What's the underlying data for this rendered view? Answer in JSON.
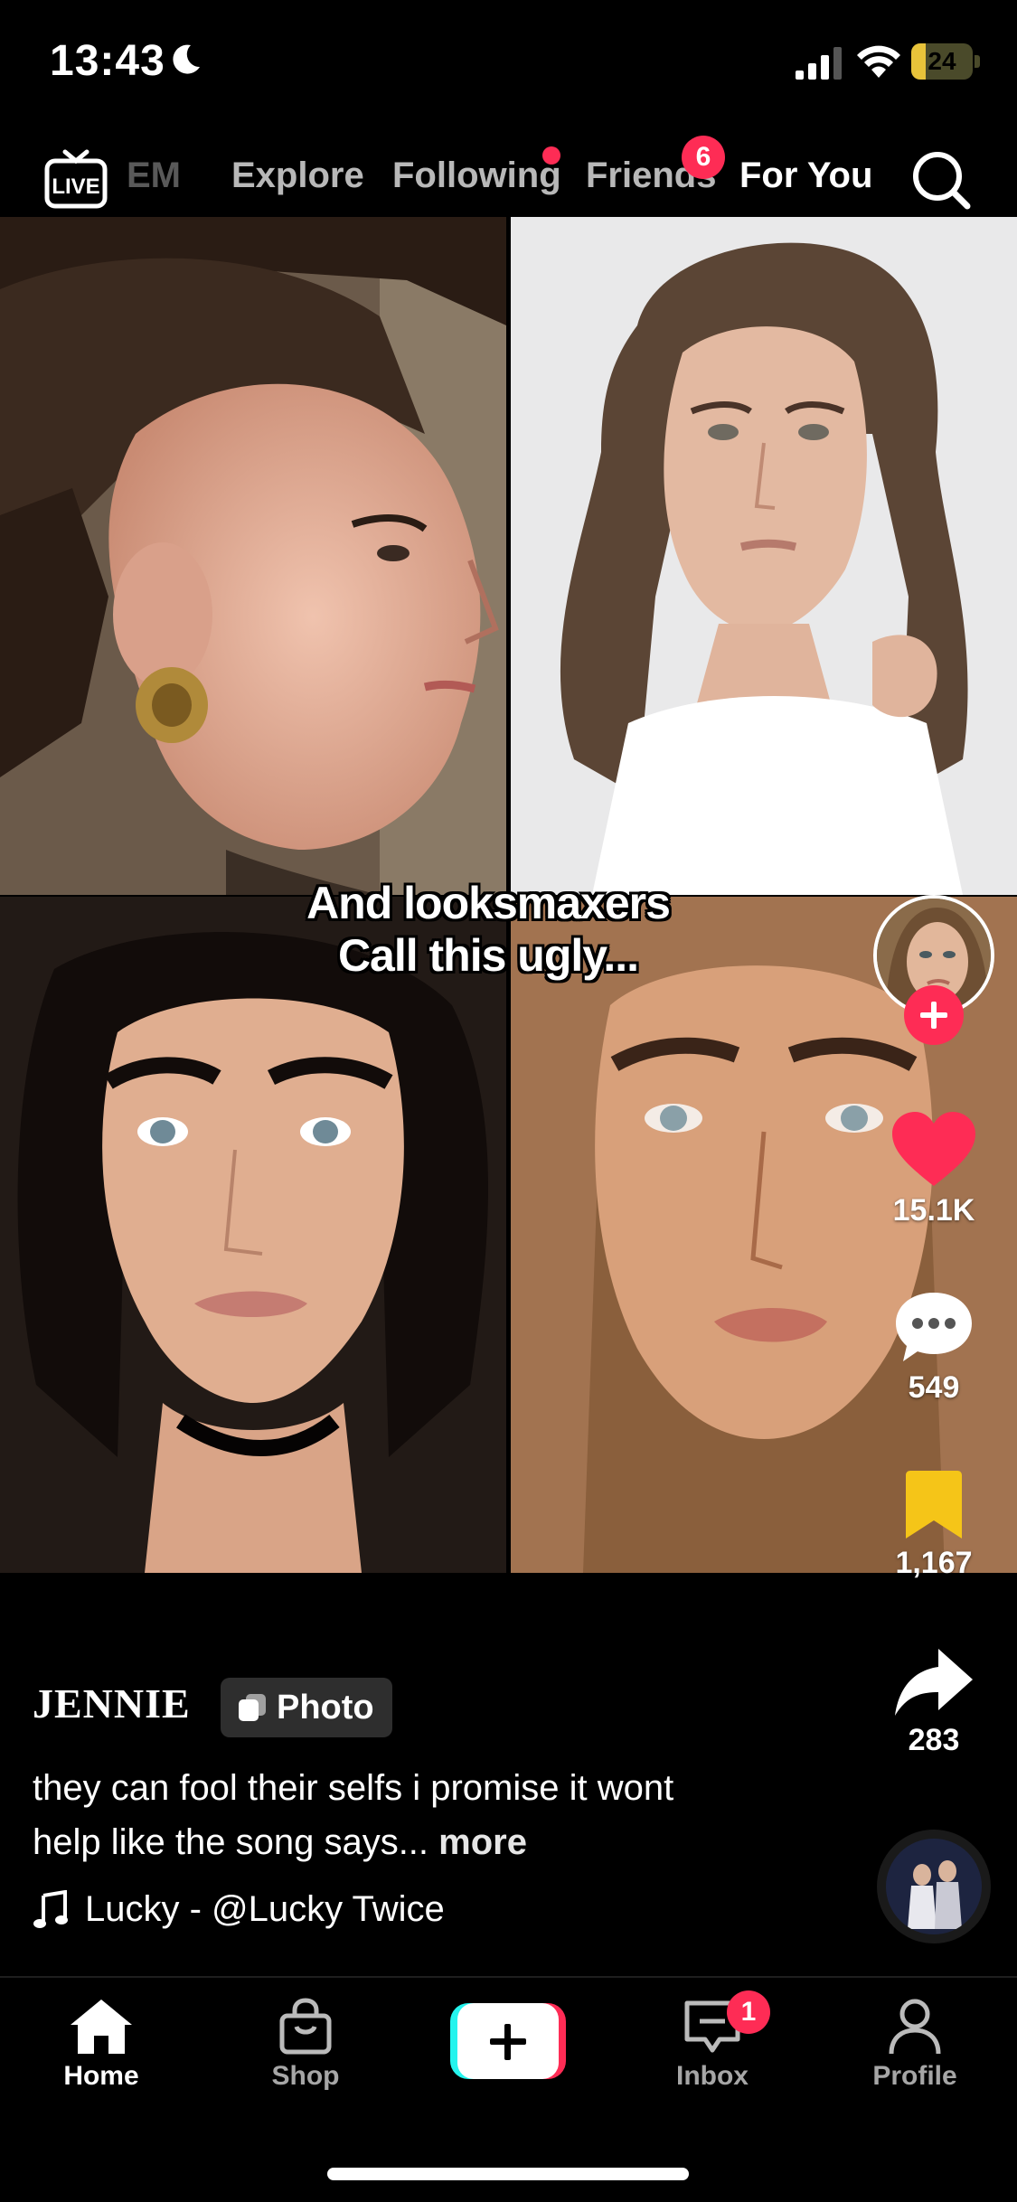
{
  "status_bar": {
    "time": "13:43",
    "battery_level": "24",
    "battery_fraction": 0.24,
    "icons": [
      "moon-icon",
      "signal-icon",
      "wifi-icon",
      "battery-icon"
    ]
  },
  "top_nav": {
    "tabs": [
      {
        "label": "EM",
        "icon": "live-icon"
      },
      {
        "label": "Explore"
      },
      {
        "label": "Following",
        "dot": true
      },
      {
        "label": "Friends",
        "badge": "6"
      },
      {
        "label": "For You",
        "active": true
      }
    ],
    "live_label": "LIVE"
  },
  "post": {
    "overlay_line1": "And looksmaxers",
    "overlay_line2": "Call this ugly...",
    "author": "JENNIE",
    "tag": "Photo",
    "description": "they can fool their selfs i promise it wont help like the song says...",
    "more": "more",
    "music": "Lucky - @Lucky Twice"
  },
  "actions": {
    "likes": "15.1K",
    "comments": "549",
    "saves": "1,167",
    "shares": "283"
  },
  "tabbar": {
    "home": "Home",
    "shop": "Shop",
    "inbox": "Inbox",
    "inbox_badge": "1",
    "profile": "Profile"
  },
  "colors": {
    "accent": "#fe2c55",
    "cyan": "#25f4ee",
    "save_yellow": "#f5c518",
    "battery_yellow": "#e8c33a"
  }
}
